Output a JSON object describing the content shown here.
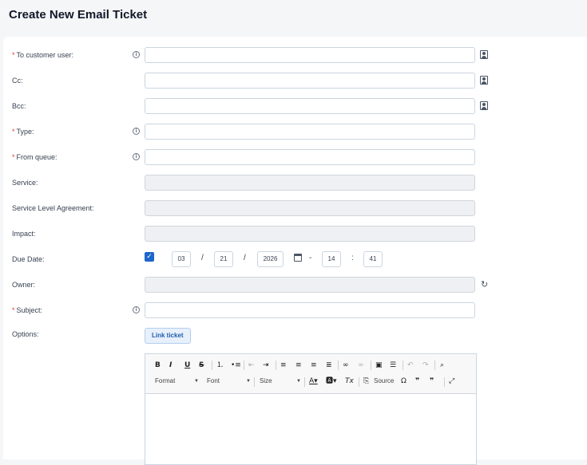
{
  "page": {
    "title": "Create New Email Ticket"
  },
  "fields": {
    "to": {
      "label": "To customer user:",
      "required": "*"
    },
    "cc": {
      "label": "Cc:"
    },
    "bcc": {
      "label": "Bcc:"
    },
    "type": {
      "label": "Type:",
      "required": "*"
    },
    "queue": {
      "label": "From queue:",
      "required": "*"
    },
    "service": {
      "label": "Service:"
    },
    "sla": {
      "label": "Service Level Agreement:"
    },
    "impact": {
      "label": "Impact:"
    },
    "due": {
      "label": "Due Date:",
      "month": "03",
      "day": "21",
      "year": "2026",
      "hour": "14",
      "minute": "41",
      "slash": "/",
      "dash": "-",
      "colon": ":",
      "checked": "✓"
    },
    "owner": {
      "label": "Owner:"
    },
    "subject": {
      "label": "Subject:",
      "required": "*"
    },
    "options": {
      "label": "Options:",
      "link_button": "Link ticket"
    }
  },
  "info_glyph": "i",
  "editor": {
    "buttons": [
      "B",
      "I",
      "U",
      "S"
    ],
    "format": "Format",
    "font": "Font",
    "size": "Size",
    "source": "Source"
  }
}
